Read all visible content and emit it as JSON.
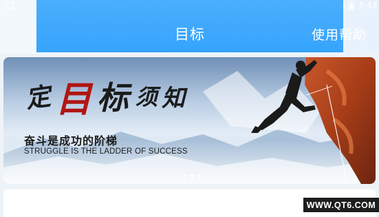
{
  "status_bar": {
    "time": "3:43",
    "icons": [
      "notification-icon",
      "wifi-icon",
      "sim-icon",
      "battery-icon"
    ]
  },
  "header": {
    "title": "目标",
    "help_label": "使用帮助",
    "color": "#36a4fd"
  },
  "banner": {
    "headline_chars": [
      "定",
      "目",
      "标",
      "须",
      "知"
    ],
    "slogan_cn": "奋斗是成功的阶梯",
    "slogan_en": "STRUGGLE IS THE LADDER OF SUCCESS",
    "page_count": 3,
    "active_index": 1
  },
  "watermark": "WWW.QT6.COM"
}
